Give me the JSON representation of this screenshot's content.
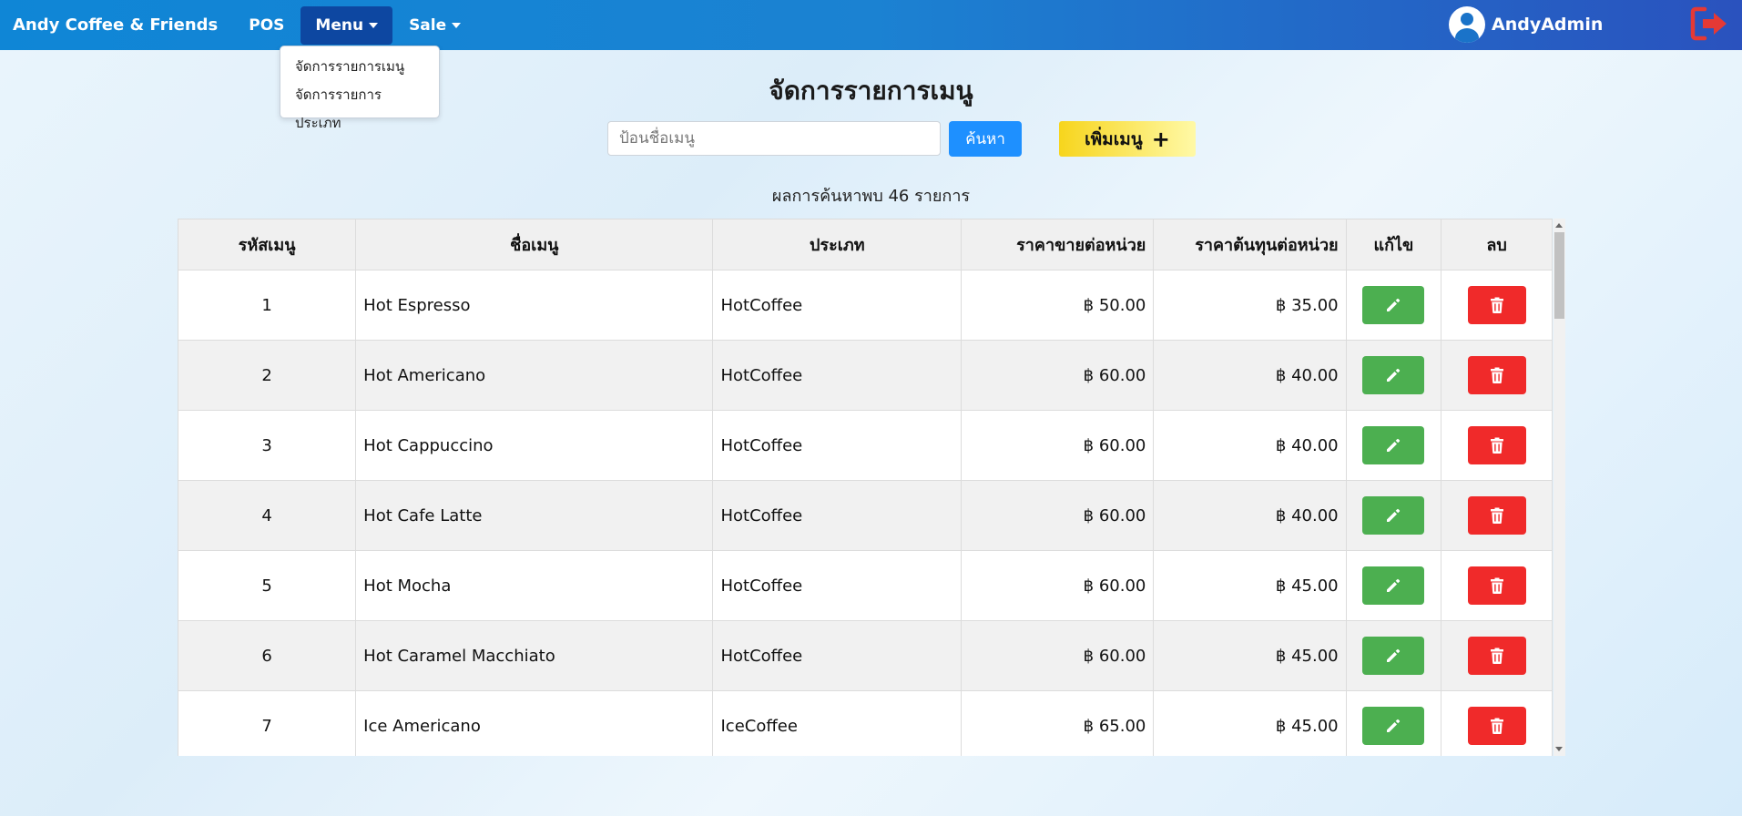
{
  "navbar": {
    "brand": "Andy Coffee & Friends",
    "pos": "POS",
    "menu": "Menu",
    "sale": "Sale",
    "username": "AndyAdmin"
  },
  "dropdown": {
    "items": [
      "จัดการรายการเมนู",
      "จัดการรายการประเภท"
    ]
  },
  "page": {
    "title": "จัดการรายการเมนู",
    "search_placeholder": "ป้อนชื่อเมนู",
    "search_button": "ค้นหา",
    "add_button": "เพิ่มเมนู",
    "add_icon": "+",
    "result_text": "ผลการค้นหาพบ 46 รายการ"
  },
  "table": {
    "headers": [
      "รหัสเมนู",
      "ชื่อเมนู",
      "ประเภท",
      "ราคาขายต่อหน่วย",
      "ราคาต้นทุนต่อหน่วย",
      "แก้ไข",
      "ลบ"
    ],
    "rows": [
      {
        "id": "1",
        "name": "Hot Espresso",
        "type": "HotCoffee",
        "price": "฿ 50.00",
        "cost": "฿ 35.00"
      },
      {
        "id": "2",
        "name": "Hot Americano",
        "type": "HotCoffee",
        "price": "฿ 60.00",
        "cost": "฿ 40.00"
      },
      {
        "id": "3",
        "name": "Hot Cappuccino",
        "type": "HotCoffee",
        "price": "฿ 60.00",
        "cost": "฿ 40.00"
      },
      {
        "id": "4",
        "name": "Hot Cafe Latte",
        "type": "HotCoffee",
        "price": "฿ 60.00",
        "cost": "฿ 40.00"
      },
      {
        "id": "5",
        "name": "Hot Mocha",
        "type": "HotCoffee",
        "price": "฿ 60.00",
        "cost": "฿ 45.00"
      },
      {
        "id": "6",
        "name": "Hot Caramel Macchiato",
        "type": "HotCoffee",
        "price": "฿ 60.00",
        "cost": "฿ 45.00"
      },
      {
        "id": "7",
        "name": "Ice Americano",
        "type": "IceCoffee",
        "price": "฿ 65.00",
        "cost": "฿ 45.00"
      },
      {
        "id": "",
        "name": "",
        "type": "",
        "price": "",
        "cost": ""
      }
    ]
  },
  "icons": {
    "avatar": "user-circle-icon",
    "logout": "logout-icon",
    "edit": "pencil-icon",
    "delete": "trash-icon"
  },
  "colors": {
    "navbar_start": "#0f86d6",
    "navbar_end": "#2a52be",
    "menu_active": "#0d47a1",
    "search_button": "#1e90ff",
    "edit_button": "#4caf50",
    "delete_button": "#f02a2a",
    "add_button": "#f7d51d",
    "logout_icon": "#e53935"
  }
}
